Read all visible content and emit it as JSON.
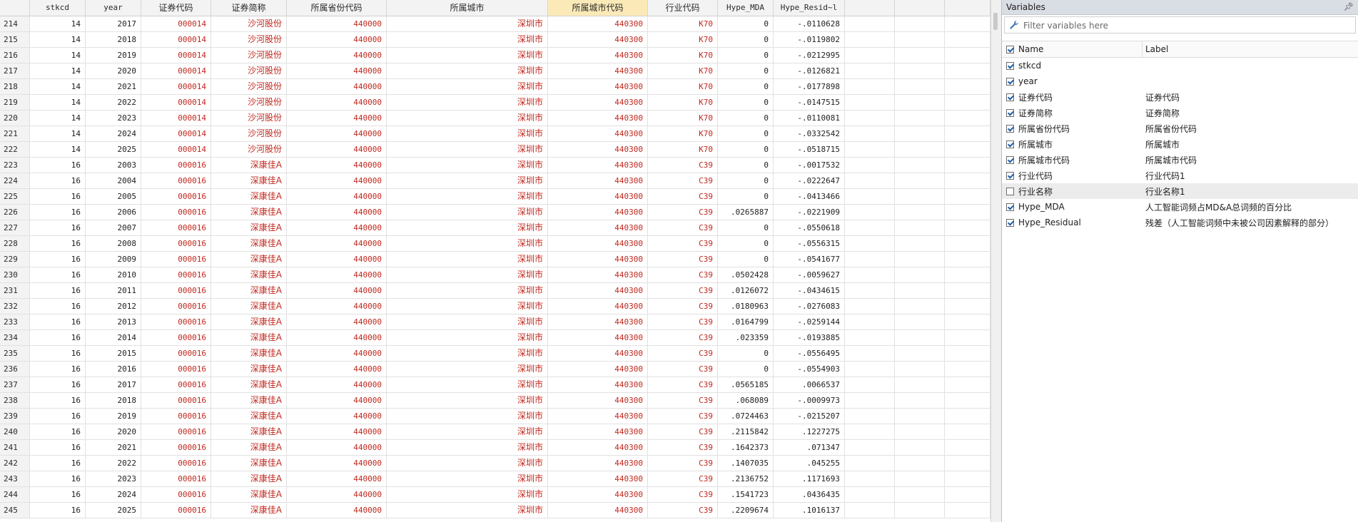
{
  "grid": {
    "columns": [
      {
        "key": "rn",
        "label": "",
        "width": 42
      },
      {
        "key": "stkcd",
        "label": "stkcd",
        "width": 78
      },
      {
        "key": "year",
        "label": "year",
        "width": 78
      },
      {
        "key": "code",
        "label": "证券代码",
        "width": 98
      },
      {
        "key": "abbr",
        "label": "证券简称",
        "width": 106
      },
      {
        "key": "prov",
        "label": "所属省份代码",
        "width": 140
      },
      {
        "key": "city",
        "label": "所属城市",
        "width": 226
      },
      {
        "key": "citycode",
        "label": "所属城市代码",
        "width": 140,
        "selected": true
      },
      {
        "key": "ind",
        "label": "行业代码",
        "width": 98
      },
      {
        "key": "mda",
        "label": "Hype_MDA",
        "width": 78
      },
      {
        "key": "resid",
        "label": "Hype_Resid~l",
        "width": 100
      },
      {
        "key": "e1",
        "label": "",
        "width": 70
      },
      {
        "key": "e2",
        "label": "",
        "width": 70
      },
      {
        "key": "e3",
        "label": "",
        "width": 64
      }
    ],
    "rows": [
      [
        "214",
        "14",
        "2017",
        "000014",
        "沙河股份",
        "440000",
        "深圳市",
        "440300",
        "K70",
        "0",
        "-.0110628"
      ],
      [
        "215",
        "14",
        "2018",
        "000014",
        "沙河股份",
        "440000",
        "深圳市",
        "440300",
        "K70",
        "0",
        "-.0119802"
      ],
      [
        "216",
        "14",
        "2019",
        "000014",
        "沙河股份",
        "440000",
        "深圳市",
        "440300",
        "K70",
        "0",
        "-.0212995"
      ],
      [
        "217",
        "14",
        "2020",
        "000014",
        "沙河股份",
        "440000",
        "深圳市",
        "440300",
        "K70",
        "0",
        "-.0126821"
      ],
      [
        "218",
        "14",
        "2021",
        "000014",
        "沙河股份",
        "440000",
        "深圳市",
        "440300",
        "K70",
        "0",
        "-.0177898"
      ],
      [
        "219",
        "14",
        "2022",
        "000014",
        "沙河股份",
        "440000",
        "深圳市",
        "440300",
        "K70",
        "0",
        "-.0147515"
      ],
      [
        "220",
        "14",
        "2023",
        "000014",
        "沙河股份",
        "440000",
        "深圳市",
        "440300",
        "K70",
        "0",
        "-.0110081"
      ],
      [
        "221",
        "14",
        "2024",
        "000014",
        "沙河股份",
        "440000",
        "深圳市",
        "440300",
        "K70",
        "0",
        "-.0332542"
      ],
      [
        "222",
        "14",
        "2025",
        "000014",
        "沙河股份",
        "440000",
        "深圳市",
        "440300",
        "K70",
        "0",
        "-.0518715"
      ],
      [
        "223",
        "16",
        "2003",
        "000016",
        "深康佳A",
        "440000",
        "深圳市",
        "440300",
        "C39",
        "0",
        "-.0017532"
      ],
      [
        "224",
        "16",
        "2004",
        "000016",
        "深康佳A",
        "440000",
        "深圳市",
        "440300",
        "C39",
        "0",
        "-.0222647"
      ],
      [
        "225",
        "16",
        "2005",
        "000016",
        "深康佳A",
        "440000",
        "深圳市",
        "440300",
        "C39",
        "0",
        "-.0413466"
      ],
      [
        "226",
        "16",
        "2006",
        "000016",
        "深康佳A",
        "440000",
        "深圳市",
        "440300",
        "C39",
        ".0265887",
        "-.0221909"
      ],
      [
        "227",
        "16",
        "2007",
        "000016",
        "深康佳A",
        "440000",
        "深圳市",
        "440300",
        "C39",
        "0",
        "-.0550618"
      ],
      [
        "228",
        "16",
        "2008",
        "000016",
        "深康佳A",
        "440000",
        "深圳市",
        "440300",
        "C39",
        "0",
        "-.0556315"
      ],
      [
        "229",
        "16",
        "2009",
        "000016",
        "深康佳A",
        "440000",
        "深圳市",
        "440300",
        "C39",
        "0",
        "-.0541677"
      ],
      [
        "230",
        "16",
        "2010",
        "000016",
        "深康佳A",
        "440000",
        "深圳市",
        "440300",
        "C39",
        ".0502428",
        "-.0059627"
      ],
      [
        "231",
        "16",
        "2011",
        "000016",
        "深康佳A",
        "440000",
        "深圳市",
        "440300",
        "C39",
        ".0126072",
        "-.0434615"
      ],
      [
        "232",
        "16",
        "2012",
        "000016",
        "深康佳A",
        "440000",
        "深圳市",
        "440300",
        "C39",
        ".0180963",
        "-.0276083"
      ],
      [
        "233",
        "16",
        "2013",
        "000016",
        "深康佳A",
        "440000",
        "深圳市",
        "440300",
        "C39",
        ".0164799",
        "-.0259144"
      ],
      [
        "234",
        "16",
        "2014",
        "000016",
        "深康佳A",
        "440000",
        "深圳市",
        "440300",
        "C39",
        ".023359",
        "-.0193885"
      ],
      [
        "235",
        "16",
        "2015",
        "000016",
        "深康佳A",
        "440000",
        "深圳市",
        "440300",
        "C39",
        "0",
        "-.0556495"
      ],
      [
        "236",
        "16",
        "2016",
        "000016",
        "深康佳A",
        "440000",
        "深圳市",
        "440300",
        "C39",
        "0",
        "-.0554903"
      ],
      [
        "237",
        "16",
        "2017",
        "000016",
        "深康佳A",
        "440000",
        "深圳市",
        "440300",
        "C39",
        ".0565185",
        ".0066537"
      ],
      [
        "238",
        "16",
        "2018",
        "000016",
        "深康佳A",
        "440000",
        "深圳市",
        "440300",
        "C39",
        ".068089",
        "-.0009973"
      ],
      [
        "239",
        "16",
        "2019",
        "000016",
        "深康佳A",
        "440000",
        "深圳市",
        "440300",
        "C39",
        ".0724463",
        "-.0215207"
      ],
      [
        "240",
        "16",
        "2020",
        "000016",
        "深康佳A",
        "440000",
        "深圳市",
        "440300",
        "C39",
        ".2115842",
        ".1227275"
      ],
      [
        "241",
        "16",
        "2021",
        "000016",
        "深康佳A",
        "440000",
        "深圳市",
        "440300",
        "C39",
        ".1642373",
        ".071347"
      ],
      [
        "242",
        "16",
        "2022",
        "000016",
        "深康佳A",
        "440000",
        "深圳市",
        "440300",
        "C39",
        ".1407035",
        ".045255"
      ],
      [
        "243",
        "16",
        "2023",
        "000016",
        "深康佳A",
        "440000",
        "深圳市",
        "440300",
        "C39",
        ".2136752",
        ".1171693"
      ],
      [
        "244",
        "16",
        "2024",
        "000016",
        "深康佳A",
        "440000",
        "深圳市",
        "440300",
        "C39",
        ".1541723",
        ".0436435"
      ],
      [
        "245",
        "16",
        "2025",
        "000016",
        "深康佳A",
        "440000",
        "深圳市",
        "440300",
        "C39",
        ".2209674",
        ".1016137"
      ]
    ]
  },
  "variables_panel": {
    "title": "Variables",
    "pin_icon": "pin-icon",
    "filter_placeholder": "Filter variables here",
    "header_name": "Name",
    "header_label": "Label",
    "items": [
      {
        "name": "stkcd",
        "label": "",
        "checked": true
      },
      {
        "name": "year",
        "label": "",
        "checked": true
      },
      {
        "name": "证券代码",
        "label": "证券代码",
        "checked": true
      },
      {
        "name": "证券简称",
        "label": "证券简称",
        "checked": true
      },
      {
        "name": "所属省份代码",
        "label": "所属省份代码",
        "checked": true
      },
      {
        "name": "所属城市",
        "label": "所属城市",
        "checked": true
      },
      {
        "name": "所属城市代码",
        "label": "所属城市代码",
        "checked": true
      },
      {
        "name": "行业代码",
        "label": "行业代码1",
        "checked": true
      },
      {
        "name": "行业名称",
        "label": "行业名称1",
        "checked": false,
        "highlighted": true
      },
      {
        "name": "Hype_MDA",
        "label": "人工智能词频占MD&A总词频的百分比",
        "checked": true
      },
      {
        "name": "Hype_Residual",
        "label": "残差（人工智能词频中未被公司因素解释的部分）",
        "checked": true
      }
    ]
  },
  "colors": {
    "string_text": "#c0281e",
    "numeric_text": "#1e1e1e",
    "selected_header": "#fbeab8",
    "panel_title_bg": "#d9dde4"
  }
}
